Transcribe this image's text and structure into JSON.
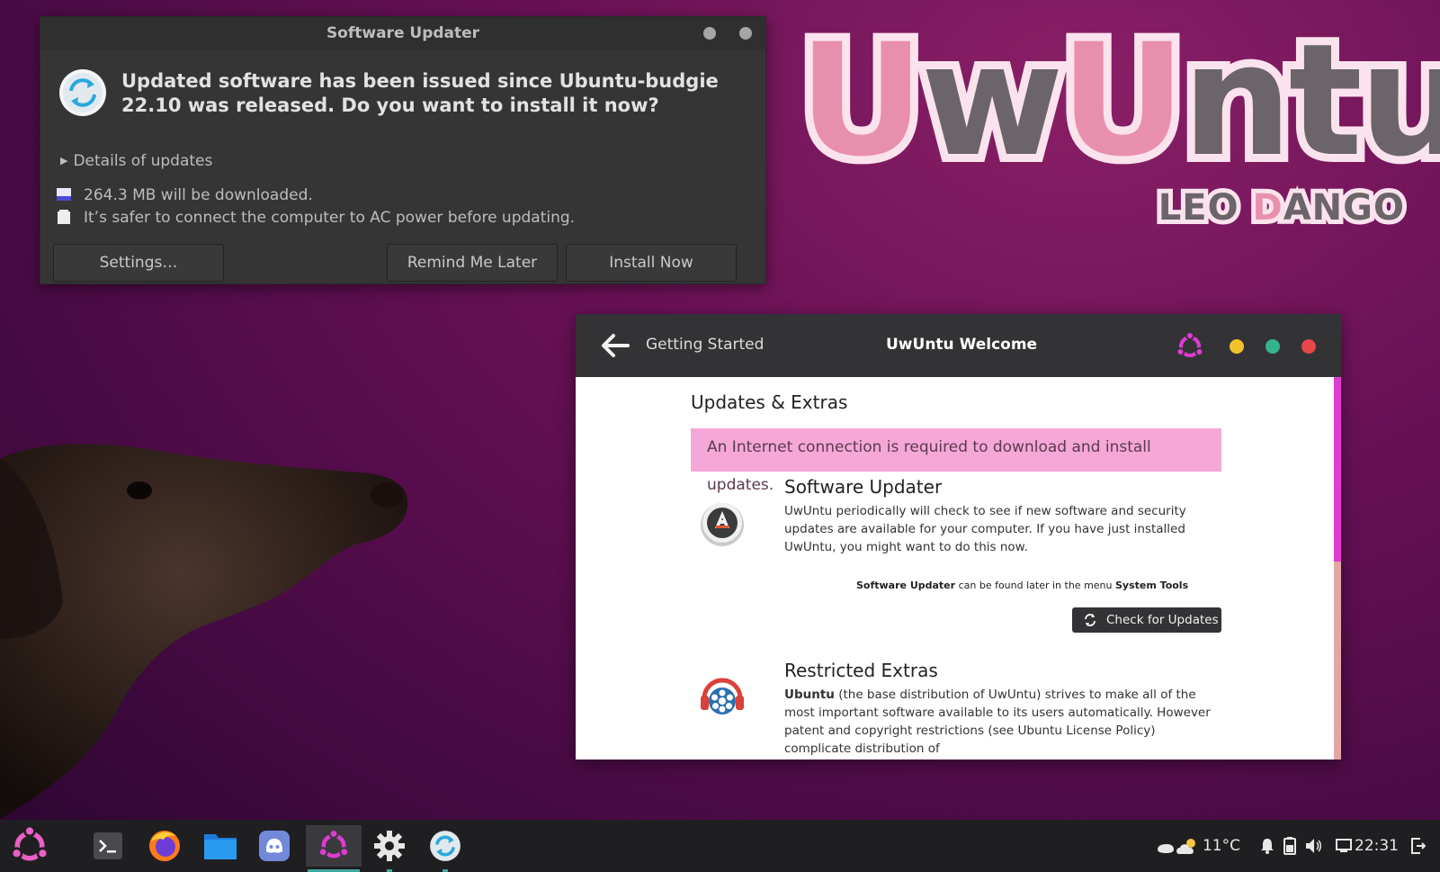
{
  "wallpaper": {
    "logo_letters": [
      "U",
      "w",
      "U",
      "n",
      "t",
      "u"
    ],
    "logo_sub_letters": [
      "LEO ",
      "D",
      "ANGO"
    ],
    "accent_pink": "#e98fae",
    "accent_gray": "#6b6468"
  },
  "updater": {
    "title": "Software Updater",
    "headline": "Updated software has been issued since Ubuntu-budgie 22.10 was released. Do you want to install it now?",
    "details_label": "Details of updates",
    "download_size": "264.3 MB will be downloaded.",
    "power_notice": "It’s safer to connect the computer to AC power before updating.",
    "buttons": {
      "settings": "Settings…",
      "remind": "Remind Me Later",
      "install": "Install Now"
    }
  },
  "welcome": {
    "crumb": "Getting Started",
    "title": "UwUntu Welcome",
    "window_dots": [
      "#f3c12b",
      "#35b38b",
      "#e8464b"
    ],
    "section_title": "Updates & Extras",
    "alert": "An Internet connection is required to download and install updates.",
    "updater_section": {
      "title": "Software Updater",
      "text": "UwUntu periodically will check to see if new software and security updates are available for your computer. If you have just installed UwUntu, you might want to do this now.",
      "note_prefix": "Software Updater",
      "note_middle": " can be found later in the menu ",
      "note_suffix": "System Tools",
      "button": "Check for Updates"
    },
    "extras_section": {
      "title": "Restricted Extras",
      "text_bold": "Ubuntu",
      "text": " (the base distribution of UwUntu) strives to make all of the most important software available to its users automatically. However patent and copyright restrictions (see Ubuntu License Policy) complicate distribution of"
    }
  },
  "panel": {
    "apps": [
      "ubuntu-menu-icon",
      "terminal-icon",
      "firefox-icon",
      "files-icon",
      "discord-icon",
      "uwuntu-welcome-icon",
      "settings-icon",
      "software-updater-icon"
    ],
    "weather": "11°C",
    "clock": "22:31"
  }
}
